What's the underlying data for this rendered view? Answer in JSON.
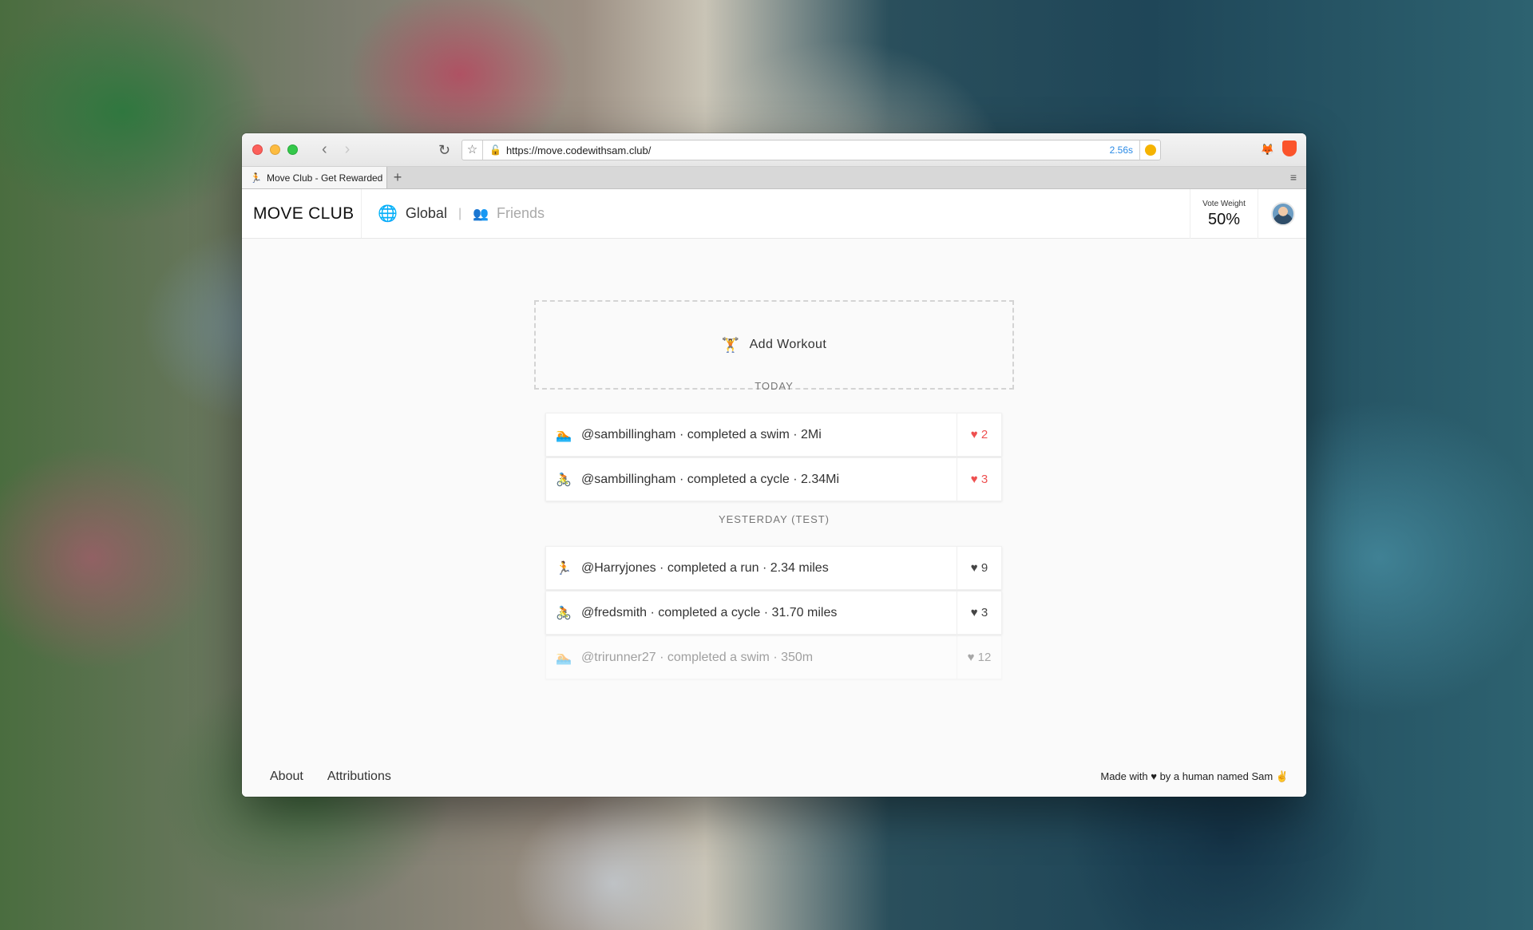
{
  "browser": {
    "url": "https://move.codewithsam.club/",
    "load_time": "2.56s",
    "tab_title": "Move Club - Get Rewarded",
    "new_tab_label": "+",
    "tab_menu_glyph": "≡"
  },
  "header": {
    "brand": "MOVE CLUB",
    "nav": {
      "global": "Global",
      "separator": "|",
      "friends": "Friends"
    },
    "vote_weight_label": "Vote Weight",
    "vote_weight_value": "50%"
  },
  "main": {
    "add_workout_label": "Add Workout",
    "sections": [
      {
        "label": "TODAY",
        "items": [
          {
            "icon": "swim-icon",
            "text": "@sambillingham · completed a swim · 2Mi",
            "likes": "♥ 2",
            "liked": true
          },
          {
            "icon": "cycle-icon",
            "text": "@sambillingham · completed a cycle · 2.34Mi",
            "likes": "♥ 3",
            "liked": true
          }
        ]
      },
      {
        "label": "YESTERDAY (TEST)",
        "items": [
          {
            "icon": "run-icon",
            "text": "@Harryjones · completed a run · 2.34 miles",
            "likes": "♥ 9",
            "liked": false
          },
          {
            "icon": "cycle-icon",
            "text": "@fredsmith · completed a cycle · 31.70 miles",
            "likes": "♥ 3",
            "liked": false
          },
          {
            "icon": "swim-icon",
            "text": "@trirunner27 · completed a swim · 350m",
            "likes": "♥ 12",
            "liked": false
          }
        ]
      }
    ]
  },
  "footer": {
    "about": "About",
    "attributions": "Attributions",
    "made_with": "Made with ♥ by a human named Sam ✌"
  },
  "colors": {
    "liked": "#ee5050",
    "link_blue": "#2a8ae6"
  }
}
